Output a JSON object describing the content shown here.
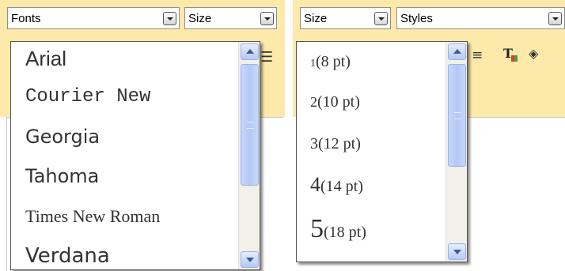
{
  "toolbar": {
    "left_group": {
      "fonts_combo": {
        "value": "Fonts"
      },
      "size_combo": {
        "value": "Size"
      }
    },
    "right_group": {
      "size_combo": {
        "value": "Size"
      },
      "styles_combo": {
        "value": "Styles"
      }
    },
    "icons": [
      "align-icon",
      "bullet-list-icon",
      "align-justify-icon",
      "text-color-icon",
      "highlight-icon"
    ]
  },
  "fonts_dropdown": {
    "items": [
      {
        "label": "Arial"
      },
      {
        "label": "Courier New"
      },
      {
        "label": "Georgia"
      },
      {
        "label": "Tahoma"
      },
      {
        "label": "Times New Roman"
      },
      {
        "label": "Verdana"
      }
    ]
  },
  "size_dropdown": {
    "items": [
      {
        "num": "1",
        "label": "(8 pt)"
      },
      {
        "num": "2",
        "label": "(10 pt)"
      },
      {
        "num": "3",
        "label": "(12 pt)"
      },
      {
        "num": "4",
        "label": "(14 pt)"
      },
      {
        "num": "5",
        "label": "(18 pt)"
      }
    ]
  },
  "colors": {
    "toolbar_bg": "#fde9a9",
    "scroll_thumb": "#b3c8f6",
    "scroll_arrow": "#3a5a9c"
  }
}
